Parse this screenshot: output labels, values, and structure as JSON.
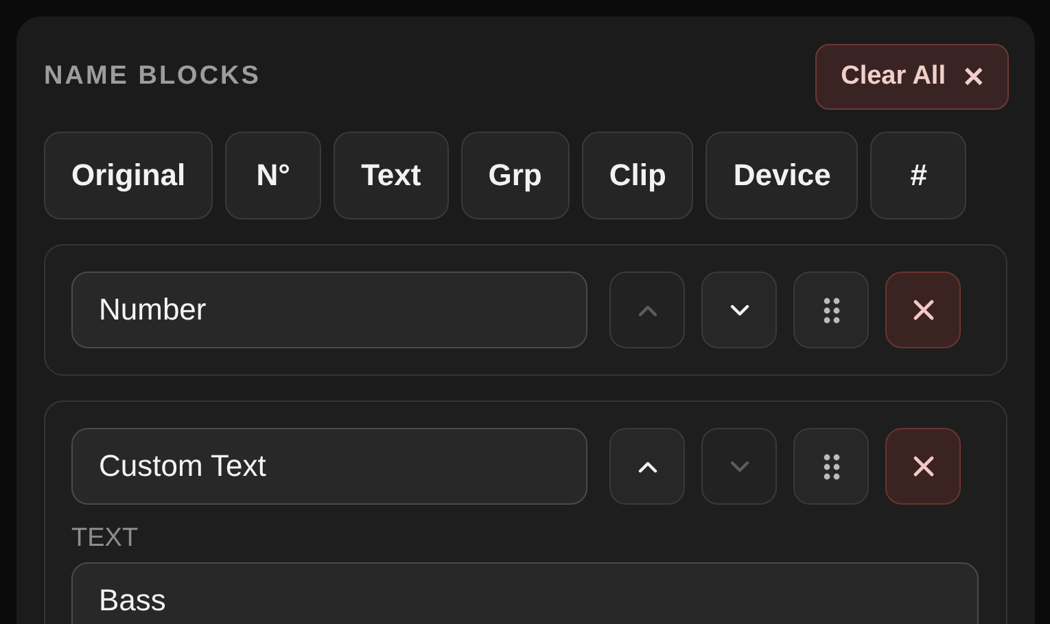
{
  "header": {
    "title": "NAME BLOCKS",
    "clear_button": "Clear All",
    "clear_icon": "✕"
  },
  "chips": [
    "Original",
    "N°",
    "Text",
    "Grp",
    "Clip",
    "Device",
    "#"
  ],
  "blocks": [
    {
      "kind": "number",
      "value": "Number",
      "up_disabled": true,
      "down_disabled": false
    },
    {
      "kind": "custom_text",
      "value": "Custom Text",
      "up_disabled": false,
      "down_disabled": true,
      "text_label": "TEXT",
      "text_value": "Bass"
    }
  ]
}
